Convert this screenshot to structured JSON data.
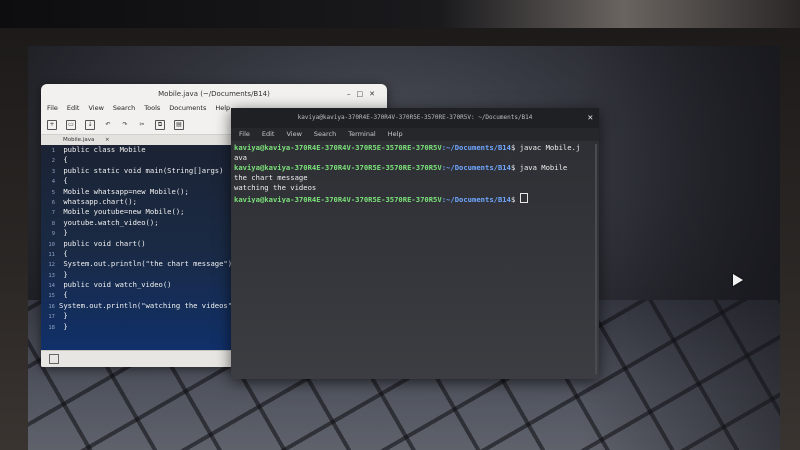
{
  "editor": {
    "title": "Mobile.java (~/Documents/B14)",
    "menu": [
      "File",
      "Edit",
      "View",
      "Search",
      "Tools",
      "Documents",
      "Help"
    ],
    "tab_label": "Mobile.java",
    "lines": [
      {
        "n": "1",
        "text": " public class Mobile"
      },
      {
        "n": "2",
        "text": " {"
      },
      {
        "n": "3",
        "text": " public static void main(String[]args)"
      },
      {
        "n": "4",
        "text": " {"
      },
      {
        "n": "5",
        "text": " Mobile whatsapp=new Mobile();"
      },
      {
        "n": "6",
        "text": " whatsapp.chart();"
      },
      {
        "n": "7",
        "text": " Mobile youtube=new Mobile();"
      },
      {
        "n": "8",
        "text": " youtube.watch_video();"
      },
      {
        "n": "9",
        "text": " }"
      },
      {
        "n": "10",
        "text": " public void chart()"
      },
      {
        "n": "11",
        "text": " {"
      },
      {
        "n": "12",
        "text": " System.out.println(\"the chart message\");"
      },
      {
        "n": "13",
        "text": " }"
      },
      {
        "n": "14",
        "text": " public void watch_video()"
      },
      {
        "n": "15",
        "text": " {"
      },
      {
        "n": "16",
        "text": "System.out.println(\"watching the videos\");"
      },
      {
        "n": "17",
        "text": " }"
      },
      {
        "n": "18",
        "text": " }"
      }
    ]
  },
  "terminal": {
    "title": "kaviya@kaviya-370R4E-370R4V-370R5E-3570RE-370R5V: ~/Documents/B14",
    "menu": [
      "File",
      "Edit",
      "View",
      "Search",
      "Terminal",
      "Help"
    ],
    "prompt_user": "kaviya@kaviya-370R4E-370R4V-370R5E-3570RE-370R5V",
    "prompt_path": ":~/Documents/B14",
    "cmd1": "$ javac Mobile.j",
    "cmd1_wrap": "ava",
    "cmd2": "$ java Mobile",
    "out1": "the chart message",
    "out2": "watching the videos",
    "cmd3": "$ "
  }
}
